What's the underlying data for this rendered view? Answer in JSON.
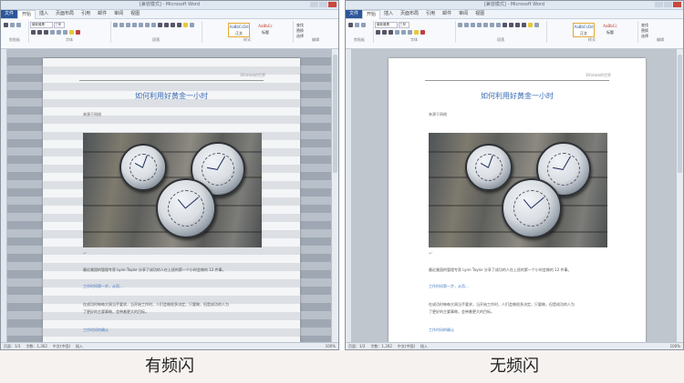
{
  "window_title": "[兼容模式] - Microsoft Word",
  "tabs": [
    "文件",
    "开始",
    "插入",
    "页面布局",
    "引用",
    "邮件",
    "审阅",
    "视图"
  ],
  "ribbon": {
    "font_name": "微软雅黑",
    "font_size": "三号",
    "group_clipboard": "剪贴板",
    "group_font": "字体",
    "group_paragraph": "段落",
    "group_styles": "样式",
    "group_edit": "编辑",
    "style_1": "AaBbCcDd",
    "style_1_name": "正文",
    "style_2": "AaBbCc",
    "style_2_name": "标题",
    "edit_find": "查找",
    "edit_replace": "替换",
    "edit_select": "选择"
  },
  "document": {
    "header_text": "ElfoHab的世界",
    "title": "如何利用好黄金一小时",
    "author": "来源于网络",
    "para1": "最近美国的管理专家 Lynn Taylor 分享了成功的人在上班的第一个小时会做的 12 件事。",
    "para2": "工作时间第一步，从而...",
    "para3": "在成功时每每大周当手要求，当开始工作时，人们会做很多决定，只要做，但是成功的人为",
    "para4": "了更好的主要事做，会带着更大的目标。",
    "para5": "工作时间的确认"
  },
  "statusbar": {
    "page": "页面：1/3",
    "words": "字数：1,302",
    "lang": "中文(中国)",
    "mode": "插入",
    "zoom": "100%"
  },
  "captions": {
    "left": "有频闪",
    "right": "无频闪"
  }
}
